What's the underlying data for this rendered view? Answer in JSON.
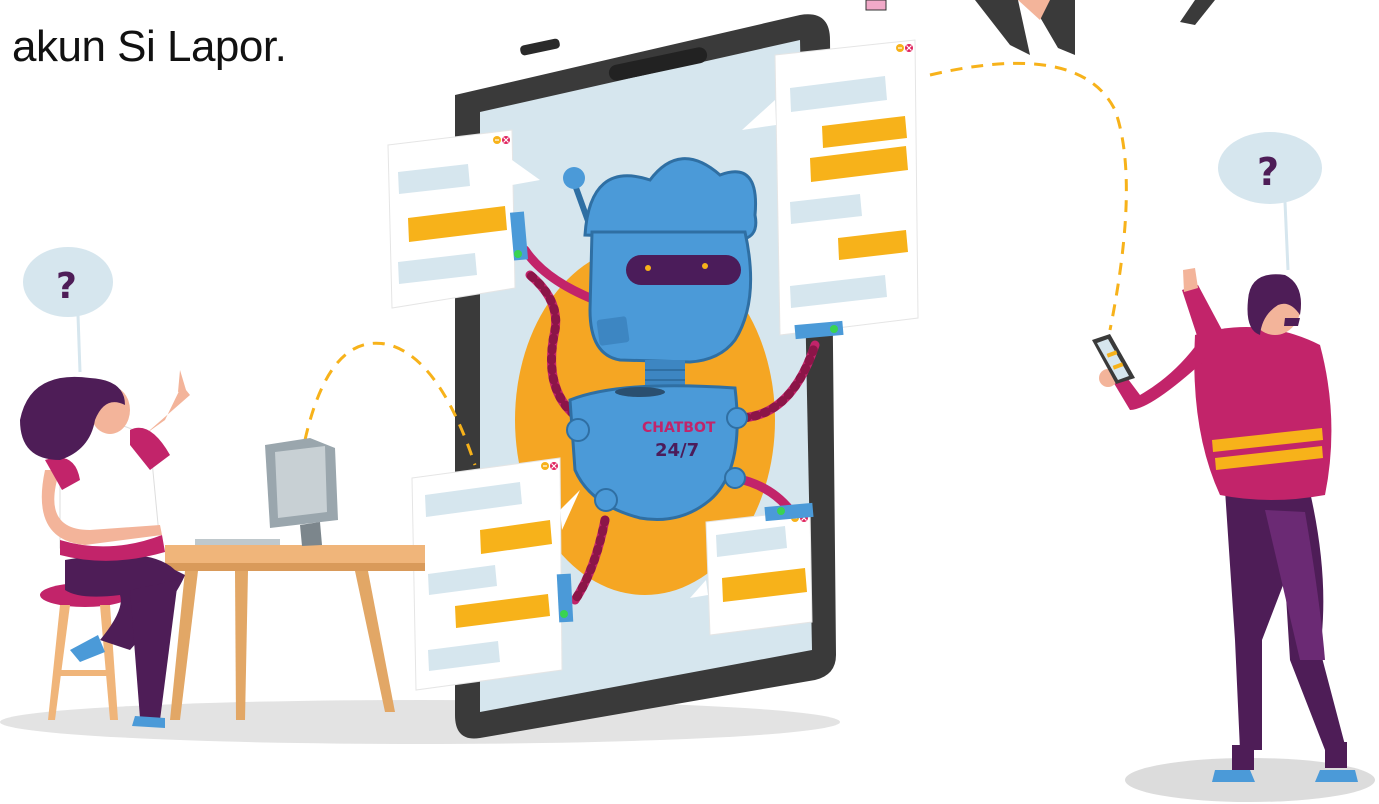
{
  "caption": "akun Si Lapor.",
  "robot": {
    "line1": "CHATBOT",
    "line2": "24/7"
  },
  "bubble_mark": "?",
  "colors": {
    "phone_frame": "#3a3a3a",
    "screen": "#d6e6ee",
    "robot": "#4b9ad8",
    "halo": "#f5a623",
    "accent_yellow": "#f7b21a",
    "magenta": "#c2246a",
    "purple": "#4e1d57",
    "thought": "#d6e6ee"
  },
  "icons": [
    "question-mark-icon",
    "minimize-icon",
    "close-icon",
    "monitor-icon",
    "tablet-icon"
  ]
}
